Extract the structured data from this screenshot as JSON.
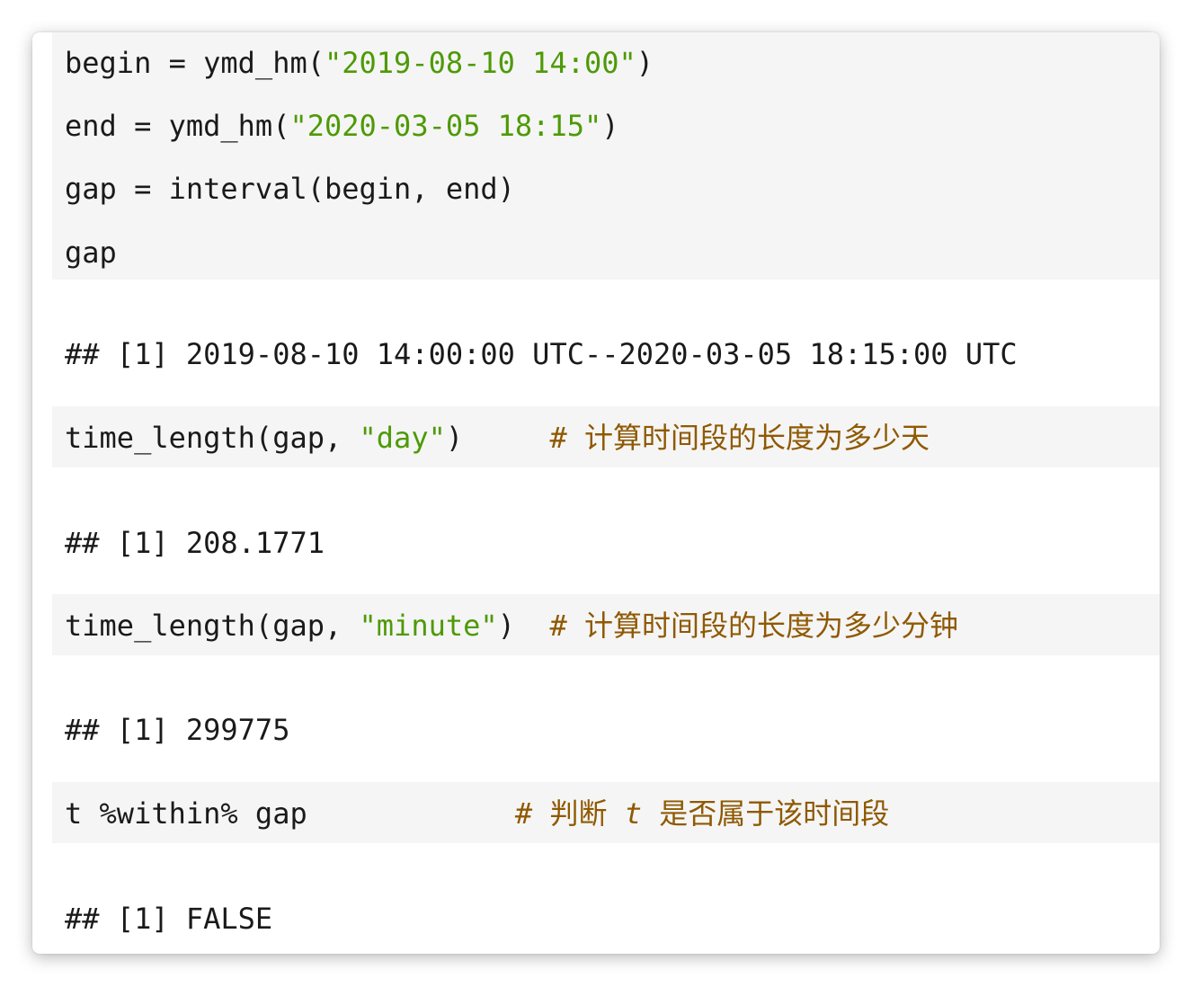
{
  "cells": [
    {
      "code": [
        {
          "parts": [
            {
              "text": "begin = ymd_hm(",
              "kind": "plain"
            },
            {
              "text": "\"2019-08-10 14:00\"",
              "kind": "string"
            },
            {
              "text": ")",
              "kind": "plain"
            }
          ]
        },
        {
          "parts": [
            {
              "text": "end = ymd_hm(",
              "kind": "plain"
            },
            {
              "text": "\"2020-03-05 18:15\"",
              "kind": "string"
            },
            {
              "text": ")",
              "kind": "plain"
            }
          ]
        },
        {
          "parts": [
            {
              "text": "gap = interval(begin, end)",
              "kind": "plain"
            }
          ]
        },
        {
          "parts": [
            {
              "text": "gap",
              "kind": "plain"
            }
          ]
        }
      ],
      "output": "## [1] 2019-08-10 14:00:00 UTC--2020-03-05 18:15:00 UTC"
    },
    {
      "code": [
        {
          "parts": [
            {
              "text": "time_length(gap, ",
              "kind": "plain"
            },
            {
              "text": "\"day\"",
              "kind": "string"
            },
            {
              "text": ")     ",
              "kind": "plain"
            },
            {
              "text": "# 计算时间段的长度为多少天",
              "kind": "comment"
            }
          ]
        }
      ],
      "output": "## [1] 208.1771"
    },
    {
      "code": [
        {
          "parts": [
            {
              "text": "time_length(gap, ",
              "kind": "plain"
            },
            {
              "text": "\"minute\"",
              "kind": "string"
            },
            {
              "text": ")  ",
              "kind": "plain"
            },
            {
              "text": "# 计算时间段的长度为多少分钟",
              "kind": "comment"
            }
          ]
        }
      ],
      "output": "## [1] 299775"
    },
    {
      "code": [
        {
          "parts": [
            {
              "text": "t %within% gap            ",
              "kind": "plain"
            },
            {
              "text": "# 判断 ",
              "kind": "comment"
            },
            {
              "text": "t",
              "kind": "comment-italic"
            },
            {
              "text": " 是否属于该时间段",
              "kind": "comment"
            }
          ]
        }
      ],
      "output": "## [1] FALSE"
    }
  ]
}
